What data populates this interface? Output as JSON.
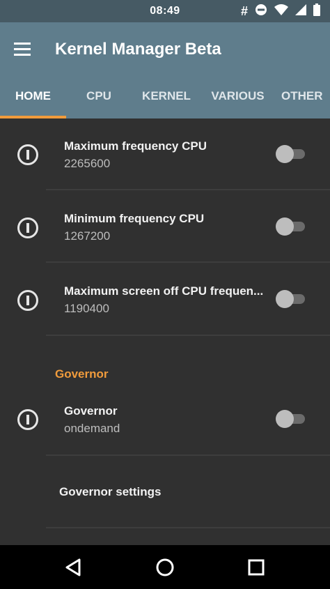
{
  "status_bar": {
    "time": "08:49",
    "icons": [
      "hashtag-icon",
      "do-not-disturb-icon",
      "wifi-icon",
      "signal-icon",
      "battery-icon"
    ]
  },
  "toolbar": {
    "title": "Kernel Manager Beta",
    "menu_icon": "hamburger-menu-icon"
  },
  "tabs": [
    {
      "label": "HOME",
      "active": true
    },
    {
      "label": "CPU",
      "active": false
    },
    {
      "label": "KERNEL",
      "active": false
    },
    {
      "label": "VARIOUS",
      "active": false
    },
    {
      "label": "OTHER",
      "active": false
    }
  ],
  "rows": [
    {
      "title": "Maximum frequency CPU",
      "value": "2265600",
      "enabled": false
    },
    {
      "title": "Minimum frequency CPU",
      "value": "1267200",
      "enabled": false
    },
    {
      "title": "Maximum screen off CPU frequen...",
      "value": "1190400",
      "enabled": false
    }
  ],
  "governor_section": {
    "header": "Governor",
    "row": {
      "title": "Governor",
      "value": "ondemand",
      "enabled": false
    },
    "settings_label": "Governor settings"
  },
  "nav_bar": {
    "buttons": [
      "back-icon",
      "home-icon",
      "recents-icon"
    ]
  },
  "colors": {
    "status_bar": "#465a64",
    "toolbar": "#5f7d8c",
    "accent": "#f09b3c",
    "background": "#303030",
    "nav_bar": "#000000"
  }
}
